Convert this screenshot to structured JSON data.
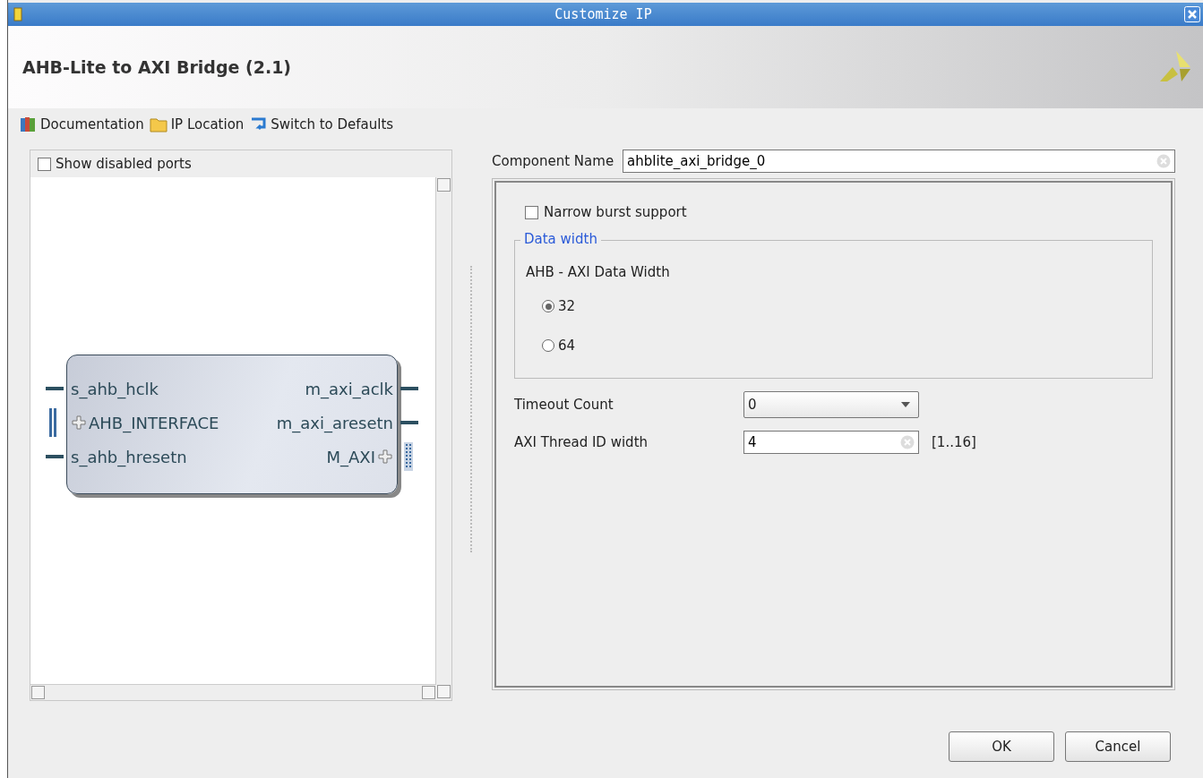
{
  "window": {
    "title": "Customize IP"
  },
  "header": {
    "title": "AHB-Lite to AXI Bridge (2.1)"
  },
  "toolbar": [
    {
      "label": "Documentation",
      "kind": "docs"
    },
    {
      "label": "IP Location",
      "kind": "folder"
    },
    {
      "label": "Switch to Defaults",
      "kind": "reset"
    }
  ],
  "symbol_panel": {
    "show_disabled_ports": {
      "label": "Show disabled ports",
      "checked": false
    },
    "left_ports": [
      {
        "name": "s_ahb_hclk",
        "kind": "wire"
      },
      {
        "name": "AHB_INTERFACE",
        "kind": "bus"
      },
      {
        "name": "s_ahb_hresetn",
        "kind": "wire"
      }
    ],
    "right_ports": [
      {
        "name": "m_axi_aclk",
        "kind": "wire"
      },
      {
        "name": "m_axi_aresetn",
        "kind": "wire"
      },
      {
        "name": "M_AXI",
        "kind": "bus"
      }
    ]
  },
  "component_name": {
    "label": "Component Name",
    "value": "ahblite_axi_bridge_0"
  },
  "options": {
    "narrow_burst": {
      "label": "Narrow burst support",
      "checked": false
    },
    "data_width": {
      "title": "Data width",
      "label": "AHB - AXI Data Width",
      "choices": [
        {
          "label": "32",
          "selected": true
        },
        {
          "label": "64",
          "selected": false
        }
      ]
    },
    "timeout": {
      "label": "Timeout Count",
      "value": "0"
    },
    "thread_id": {
      "label": "AXI Thread ID width",
      "value": "4",
      "range": "[1..16]"
    }
  },
  "buttons": [
    "OK",
    "Cancel"
  ]
}
